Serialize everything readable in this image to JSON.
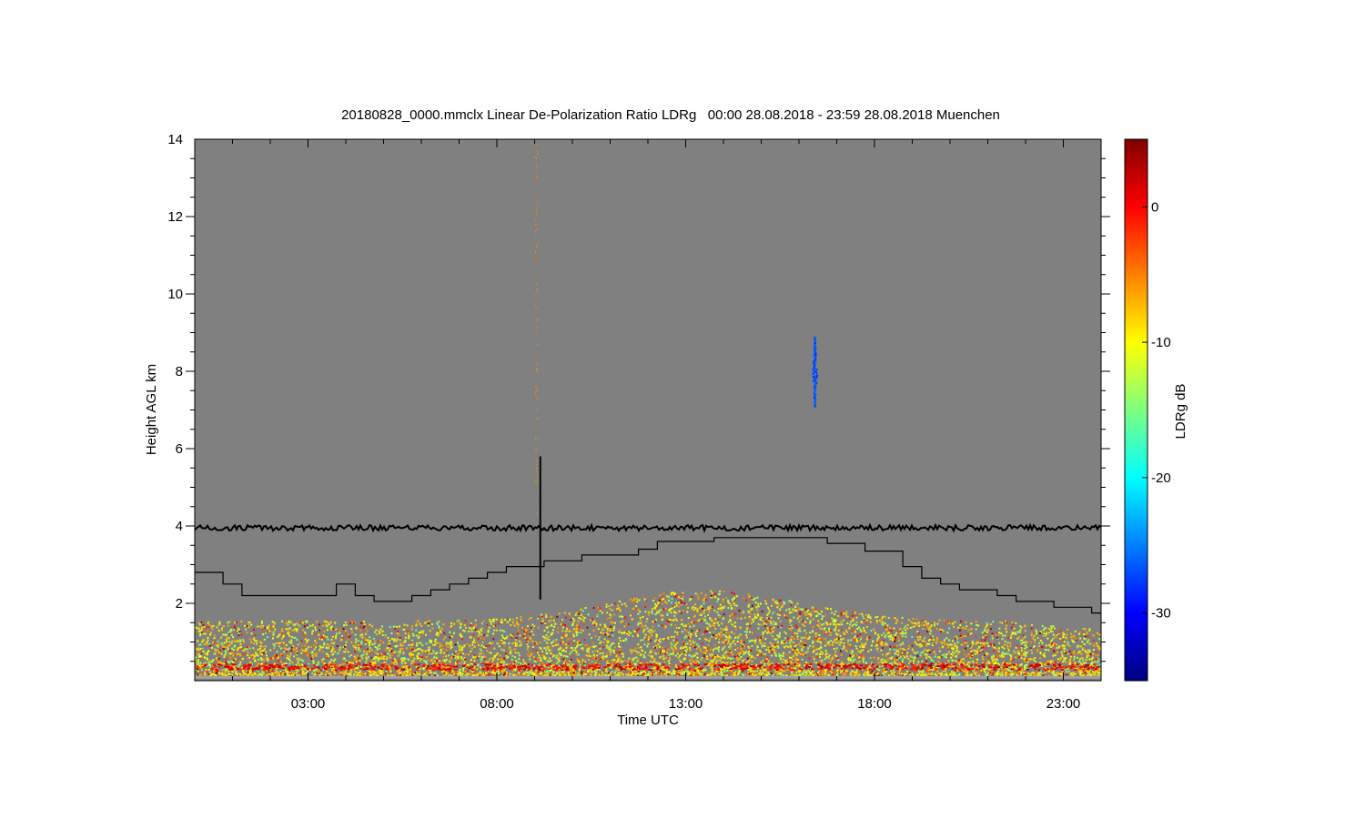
{
  "chart_data": {
    "type": "heatmap",
    "title": "20180828_0000.mmclx Linear De-Polarization Ratio LDRg   00:00 28.08.2018 - 23:59 28.08.2018 Muenchen",
    "xlabel": "Time UTC",
    "ylabel": "Height AGL km",
    "colorbar_label": "LDRg dB",
    "x_unit": "hours UTC",
    "xlim": [
      0,
      24
    ],
    "ylim": [
      0,
      14
    ],
    "x_ticks": [
      {
        "value": 3,
        "label": "03:00"
      },
      {
        "value": 8,
        "label": "08:00"
      },
      {
        "value": 13,
        "label": "13:00"
      },
      {
        "value": 18,
        "label": "18:00"
      },
      {
        "value": 23,
        "label": "23:00"
      }
    ],
    "y_ticks": [
      {
        "value": 2,
        "label": "2"
      },
      {
        "value": 4,
        "label": "4"
      },
      {
        "value": 6,
        "label": "6"
      },
      {
        "value": 8,
        "label": "8"
      },
      {
        "value": 10,
        "label": "10"
      },
      {
        "value": 12,
        "label": "12"
      },
      {
        "value": 14,
        "label": "14"
      }
    ],
    "colorbar": {
      "range": [
        -35,
        5
      ],
      "ticks": [
        {
          "value": 0,
          "label": "0"
        },
        {
          "value": -10,
          "label": "-10"
        },
        {
          "value": -20,
          "label": "-20"
        },
        {
          "value": -30,
          "label": "-30"
        }
      ],
      "colormap": [
        "#00007f",
        "#0000ff",
        "#007fff",
        "#00ffff",
        "#7fff7f",
        "#ffff00",
        "#ff7f00",
        "#ff0000",
        "#7f0000"
      ]
    },
    "background_color": "#808080",
    "noise_line": {
      "height_km": 3.95,
      "x_range": [
        0,
        24
      ]
    },
    "boundary_layer_line": {
      "x": [
        0,
        0.75,
        1.25,
        3.75,
        4.25,
        4.75,
        5.75,
        6.25,
        6.75,
        7.25,
        7.75,
        8.25,
        9.25,
        10.25,
        11.75,
        12.25,
        13.75,
        14.75,
        16.75,
        17.75,
        18.75,
        19.25,
        19.75,
        20.25,
        21.25,
        21.75,
        22.25,
        22.75,
        23.75,
        24
      ],
      "y": [
        2.8,
        2.5,
        2.2,
        2.5,
        2.2,
        2.05,
        2.2,
        2.35,
        2.5,
        2.65,
        2.8,
        2.95,
        3.1,
        3.25,
        3.4,
        3.6,
        3.7,
        3.7,
        3.55,
        3.35,
        2.95,
        2.65,
        2.5,
        2.35,
        2.2,
        2.05,
        2.05,
        1.9,
        1.75,
        1.75
      ]
    },
    "spike": {
      "x": 9.15,
      "y_range": [
        2.1,
        5.8
      ]
    },
    "cloud_patch": {
      "x": 16.4,
      "y_range": [
        7.1,
        8.9
      ],
      "ldr_db": -27
    }
  }
}
